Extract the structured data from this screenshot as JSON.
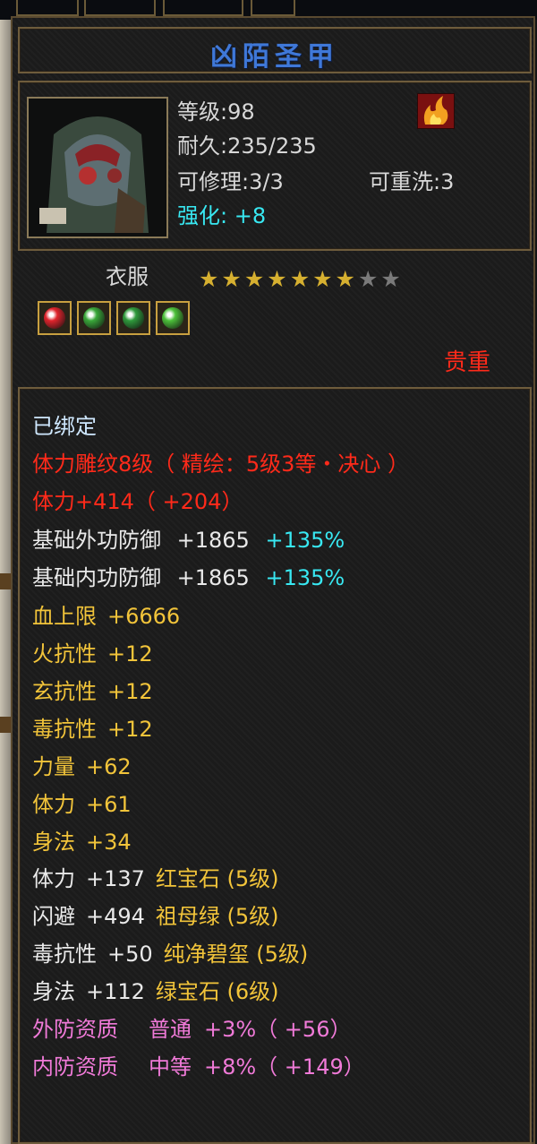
{
  "item": {
    "name": "凶陌圣甲",
    "level": "等级:98",
    "durability": "耐久:235/235",
    "repair": "可修理:3/3",
    "rewash": "可重洗:3",
    "enhance_label": "强化:",
    "enhance_value": "+8",
    "type": "衣服",
    "stars_filled": 7,
    "stars_total": 9,
    "rarity": "贵重",
    "bound": "已绑定"
  },
  "gems": [
    {
      "name": "ruby-gem",
      "color": "#e0242c"
    },
    {
      "name": "emerald-gem",
      "color": "#3aa83a"
    },
    {
      "name": "jade-gem",
      "color": "#2f9a3c"
    },
    {
      "name": "green-gem",
      "color": "#4cc03a"
    }
  ],
  "stats": {
    "engrave": "体力雕纹8级（ 精绘：5级3等・决心 ）",
    "stamina_main": "体力+414（ +204）",
    "outer_def": "基础外功防御",
    "outer_def_val": "+1865",
    "outer_def_pct": "+135%",
    "inner_def": "基础内功防御",
    "inner_def_val": "+1865",
    "inner_def_pct": "+135%",
    "hp_max": "血上限",
    "hp_max_val": "+6666",
    "fire_res": "火抗性",
    "fire_res_val": "+12",
    "xuan_res": "玄抗性",
    "xuan_res_val": "+12",
    "poison_res": "毒抗性",
    "poison_res_val": "+12",
    "strength": "力量",
    "strength_val": "+62",
    "stamina": "体力",
    "stamina_val": "+61",
    "agility": "身法",
    "agility_val": "+34"
  },
  "gem_stats": [
    {
      "stat": "体力",
      "value": "+137",
      "gem": "红宝石 (5级)"
    },
    {
      "stat": "闪避",
      "value": "+494",
      "gem": "祖母绿 (5级)"
    },
    {
      "stat": "毒抗性",
      "value": "+50",
      "gem": "纯净碧玺 (5级)"
    },
    {
      "stat": "身法",
      "value": "+112",
      "gem": "绿宝石 (6级)"
    }
  ],
  "quality": [
    {
      "label": "外防资质",
      "grade": "普通",
      "value": "+3%（ +56）"
    },
    {
      "label": "内防资质",
      "grade": "中等",
      "value": "+8%（ +149）"
    }
  ],
  "colors": {
    "title": "#3f78d8",
    "rarity": "#ff2a1a",
    "enhance": "#38e8f2",
    "engrave": "#ff2a1a",
    "attributes": "#f2c43a",
    "quality": "#f07ad8"
  }
}
